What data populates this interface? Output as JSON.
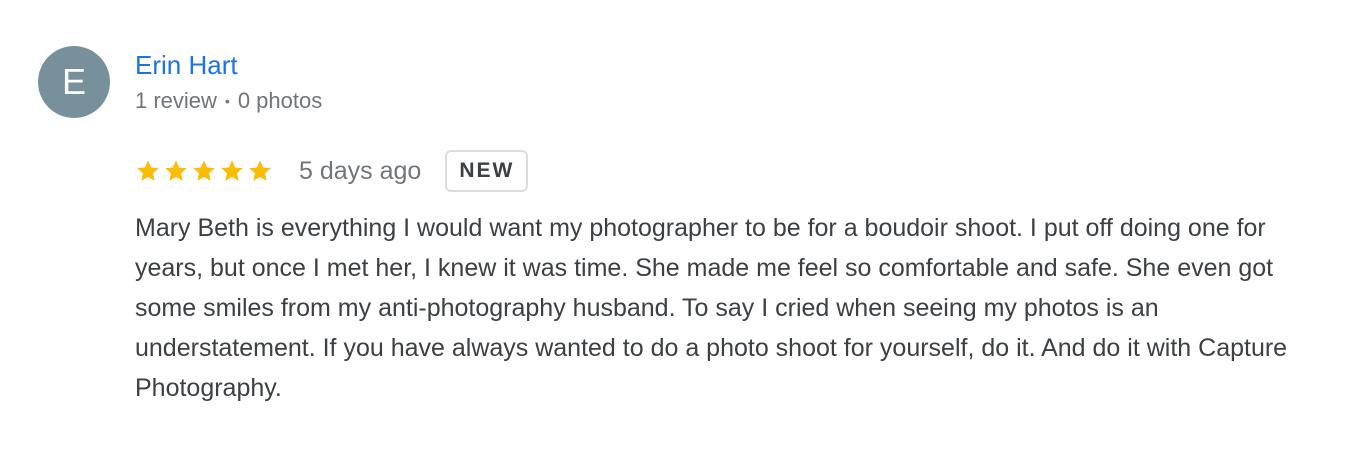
{
  "reviewer": {
    "initial": "E",
    "avatar_color": "#78909c",
    "name": "Erin Hart",
    "reviews": "1 review",
    "separator": "•",
    "photos": "0 photos"
  },
  "rating": {
    "stars": 5,
    "max_stars": 5,
    "star_color": "#fbbc04",
    "star_icon": "star-icon",
    "date": "5 days ago",
    "badge": "NEW"
  },
  "review": {
    "text": "Mary Beth is everything I would want my photographer to be for a boudoir shoot. I put off doing one for years, but once I met her, I knew it was time. She made me feel so comfortable and safe. She even got some smiles from my anti-photography husband. To say I cried when seeing my photos is an understatement. If you have always wanted to do a photo shoot for yourself, do it. And do it with Capture Photography."
  },
  "colors": {
    "link": "#1a73e8",
    "muted": "#70757a",
    "body": "#3c4043"
  }
}
